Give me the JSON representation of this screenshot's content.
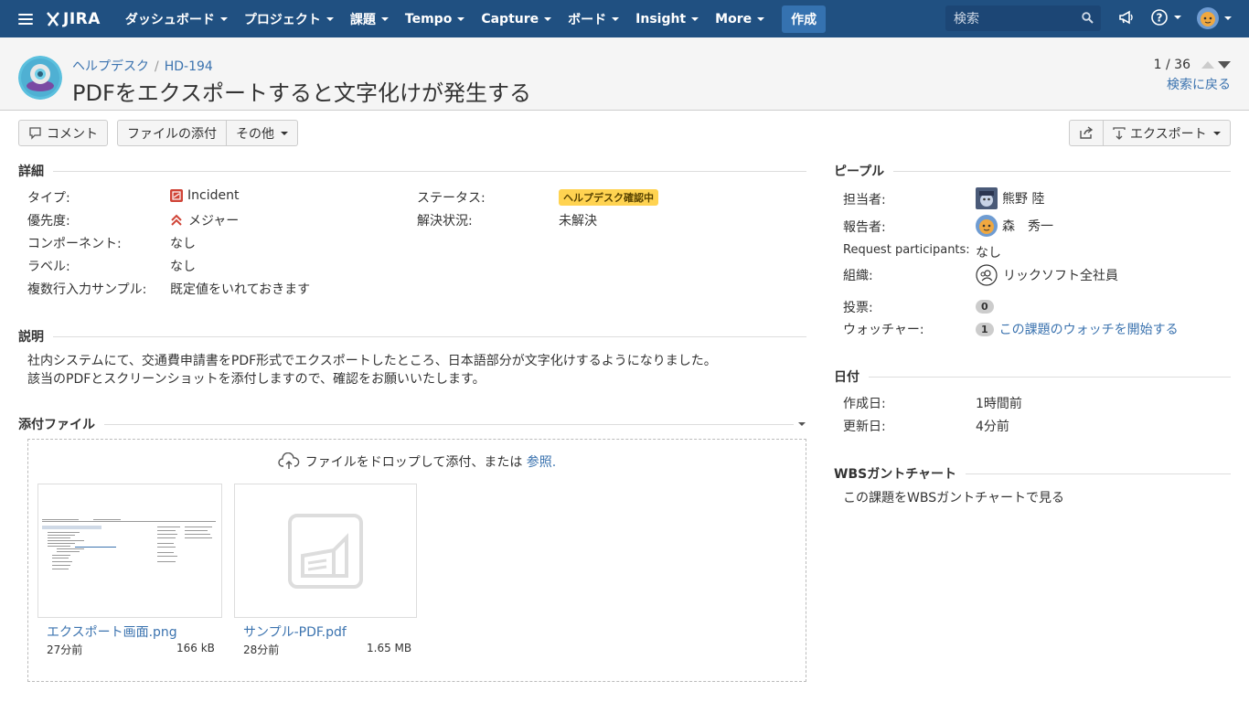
{
  "nav": {
    "logo": "JIRA",
    "items": [
      "ダッシュボード",
      "プロジェクト",
      "課題",
      "Tempo",
      "Capture",
      "ボード",
      "Insight",
      "More"
    ],
    "create": "作成",
    "search_placeholder": "検索"
  },
  "issue": {
    "breadcrumb_project": "ヘルプデスク",
    "breadcrumb_sep": "/",
    "key": "HD-194",
    "summary": "PDFをエクスポートすると文字化けが発生する",
    "pager": "1 / 36",
    "back": "検索に戻る"
  },
  "toolbar": {
    "comment": "コメント",
    "attach": "ファイルの添付",
    "more": "その他",
    "export": "エクスポート"
  },
  "details": {
    "heading": "詳細",
    "type_label": "タイプ:",
    "type_value": "Incident",
    "priority_label": "優先度:",
    "priority_value": "メジャー",
    "component_label": "コンポーネント:",
    "component_value": "なし",
    "labels_label": "ラベル:",
    "labels_value": "なし",
    "multiline_label": "複数行入力サンプル:",
    "multiline_value": "既定値をいれておきます",
    "status_label": "ステータス:",
    "status_value": "ヘルプデスク確認中",
    "resolution_label": "解決状況:",
    "resolution_value": "未解決"
  },
  "description": {
    "heading": "説明",
    "line1": "社内システムにて、交通費申請書をPDF形式でエクスポートしたところ、日本語部分が文字化けするようになりました。",
    "line2": "該当のPDFとスクリーンショットを添付しますので、確認をお願いいたします。"
  },
  "attachments": {
    "heading": "添付ファイル",
    "drop_text": "ファイルをドロップして添付、または",
    "browse": "参照.",
    "files": [
      {
        "name": "エクスポート画面.png",
        "age": "27分前",
        "size": "166 kB"
      },
      {
        "name": "サンプル-PDF.pdf",
        "age": "28分前",
        "size": "1.65 MB"
      }
    ]
  },
  "people": {
    "heading": "ピープル",
    "assignee_label": "担当者:",
    "assignee": "熊野 陸",
    "reporter_label": "報告者:",
    "reporter": "森　秀一",
    "participants_label": "Request participants:",
    "participants": "なし",
    "org_label": "組織:",
    "org": "リックソフト全社員",
    "votes_label": "投票:",
    "votes": "0",
    "watchers_label": "ウォッチャー:",
    "watchers": "1",
    "watch_link": "この課題のウォッチを開始する"
  },
  "dates": {
    "heading": "日付",
    "created_label": "作成日:",
    "created": "1時間前",
    "updated_label": "更新日:",
    "updated": "4分前"
  },
  "wbs": {
    "heading": "WBSガントチャート",
    "link": "この課題をWBSガントチャートで見る"
  },
  "colors": {
    "nav_bg": "#205081",
    "link": "#3b73af",
    "status": "#ffd351",
    "incident": "#d04437"
  }
}
